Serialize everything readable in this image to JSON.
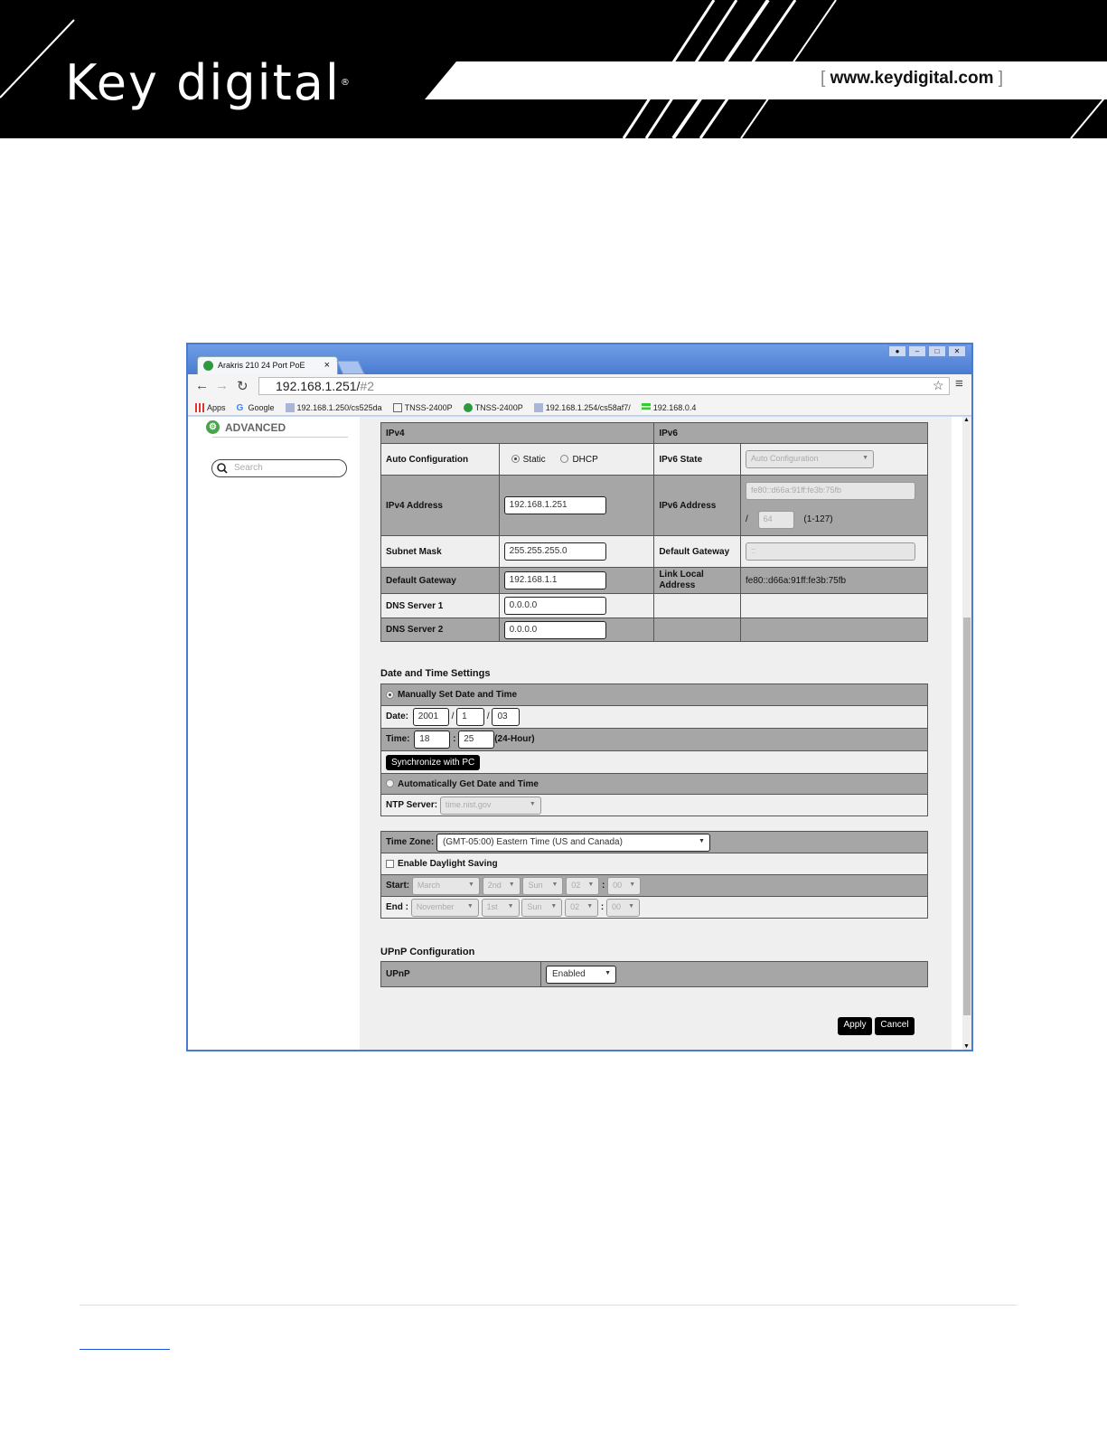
{
  "banner": {
    "logo_text": "Key digital",
    "logo_mark": "®",
    "url_open": "[",
    "url": "www.keydigital.com",
    "url_close": "]"
  },
  "browser": {
    "tab_title": "Arakris 210 24 Port PoE",
    "tab_close": "×",
    "address_host": "192.168.1.251/",
    "address_hash": "#2",
    "bookmarks": [
      "Apps",
      "Google",
      "192.168.1.250/cs525da",
      "TNSS-2400P",
      "TNSS-2400P",
      "192.168.1.254/cs58af7/",
      "192.168.0.4"
    ]
  },
  "sidebar": {
    "advanced_label": "ADVANCED",
    "search_placeholder": "Search"
  },
  "ip": {
    "ipv4_header": "IPv4",
    "ipv6_header": "IPv6",
    "auto_config_label": "Auto Configuration",
    "static_label": "Static",
    "dhcp_label": "DHCP",
    "ipv6_state_label": "IPv6 State",
    "ipv6_state_value": "Auto Configuration",
    "ipv4_address_label": "IPv4 Address",
    "ipv4_address_value": "192.168.1.251",
    "ipv6_address_label": "IPv6 Address",
    "ipv6_address_value": "fe80::d66a:91ff:fe3b:75fb",
    "ipv6_prefix_slash": "/",
    "ipv6_prefix_value": "64",
    "ipv6_prefix_range": "(1-127)",
    "subnet_label": "Subnet Mask",
    "subnet_value": "255.255.255.0",
    "ipv6_gateway_label": "Default Gateway",
    "ipv6_gateway_value": "::",
    "gateway_label": "Default Gateway",
    "gateway_value": "192.168.1.1",
    "link_local_label": "Link Local Address",
    "link_local_value": "fe80::d66a:91ff:fe3b:75fb",
    "dns1_label": "DNS Server 1",
    "dns1_value": "0.0.0.0",
    "dns2_label": "DNS Server 2",
    "dns2_value": "0.0.0.0"
  },
  "datetime": {
    "section_title": "Date and Time Settings",
    "manual_label": "Manually Set Date and Time",
    "date_label": "Date:",
    "year": "2001",
    "month": "1",
    "day": "03",
    "sep": "/",
    "time_label": "Time:",
    "hour": "18",
    "minute": "25",
    "colon": ":",
    "hour_format": "(24-Hour)",
    "sync_button": "Synchronize with PC",
    "auto_label": "Automatically Get Date and Time",
    "ntp_label": "NTP Server:",
    "ntp_value": "time.nist.gov"
  },
  "timezone": {
    "label": "Time Zone:",
    "value": "(GMT-05:00) Eastern Time (US and Canada)",
    "dst_label": "Enable Daylight Saving",
    "start_label": "Start:",
    "start": [
      "March",
      "2nd",
      "Sun",
      "02",
      "00"
    ],
    "end_label": "End :",
    "end": [
      "November",
      "1st",
      "Sun",
      "02",
      "00"
    ]
  },
  "upnp": {
    "section_title": "UPnP Configuration",
    "label": "UPnP",
    "value": "Enabled"
  },
  "actions": {
    "apply": "Apply",
    "cancel": "Cancel"
  }
}
